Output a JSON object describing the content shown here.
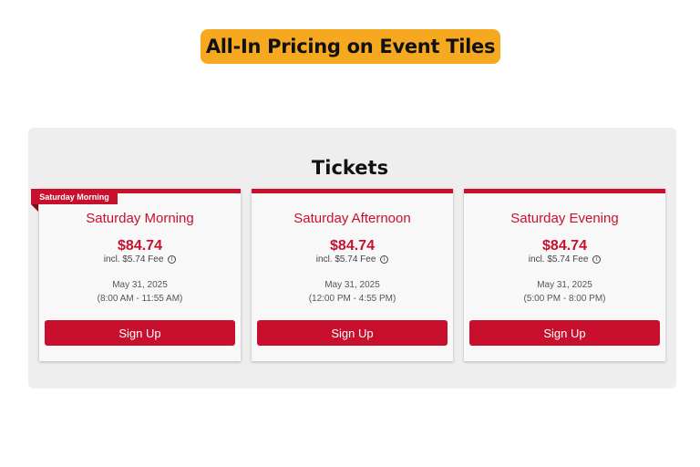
{
  "headline": "All-In Pricing on Event Tiles",
  "section_title": "Tickets",
  "ribbon_label": "Saturday Morning",
  "accent_color": "#c8102e",
  "headline_bg": "#f6a821",
  "cards": [
    {
      "name": "Saturday Morning",
      "price": "$84.74",
      "fee": "incl. $5.74 Fee",
      "date": "May 31, 2025",
      "time": "(8:00 AM - 11:55 AM)",
      "button": "Sign Up"
    },
    {
      "name": "Saturday Afternoon",
      "price": "$84.74",
      "fee": "incl. $5.74 Fee",
      "date": "May 31, 2025",
      "time": "(12:00 PM - 4:55 PM)",
      "button": "Sign Up"
    },
    {
      "name": "Saturday Evening",
      "price": "$84.74",
      "fee": "incl. $5.74 Fee",
      "date": "May 31, 2025",
      "time": "(5:00 PM - 8:00 PM)",
      "button": "Sign Up"
    }
  ],
  "info_icon_glyph": "i"
}
